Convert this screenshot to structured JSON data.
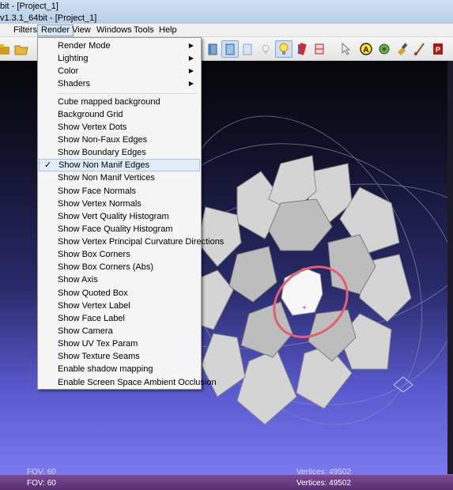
{
  "window": {
    "title": "bit - [Project_1]",
    "subtitle": "v1.3.1_64bit - [Project_1]"
  },
  "menubar": {
    "items": [
      {
        "label": "Filters"
      },
      {
        "label": "Render"
      },
      {
        "label": "View"
      },
      {
        "label": "Windows"
      },
      {
        "label": "Tools"
      },
      {
        "label": "Help"
      }
    ]
  },
  "render_menu": {
    "submenus": [
      {
        "label": "Render Mode"
      },
      {
        "label": "Lighting"
      },
      {
        "label": "Color"
      },
      {
        "label": "Shaders"
      }
    ],
    "items": [
      {
        "label": "Cube mapped background"
      },
      {
        "label": "Background Grid"
      },
      {
        "label": "Show Vertex Dots"
      },
      {
        "label": "Show Non-Faux Edges"
      },
      {
        "label": "Show Boundary Edges"
      },
      {
        "label": "Show Non Manif Edges",
        "checked": true
      },
      {
        "label": "Show Non Manif Vertices"
      },
      {
        "label": "Show Face Normals"
      },
      {
        "label": "Show Vertex Normals"
      },
      {
        "label": "Show Vert Quality Histogram"
      },
      {
        "label": "Show Face Quality Histogram"
      },
      {
        "label": "Show Vertex Principal Curvature Directions"
      },
      {
        "label": "Show Box Corners"
      },
      {
        "label": "Show Box Corners (Abs)"
      },
      {
        "label": "Show Axis"
      },
      {
        "label": "Show Quoted Box"
      },
      {
        "label": "Show Vertex Label"
      },
      {
        "label": "Show Face Label"
      },
      {
        "label": "Show Camera"
      },
      {
        "label": "Show UV Tex Param"
      },
      {
        "label": "Show Texture Seams"
      },
      {
        "label": "Enable shadow mapping"
      },
      {
        "label": "Enable Screen Space Ambient Occlusion"
      }
    ],
    "check_mark": "✓"
  },
  "viewport": {
    "fov": "FOV: 60",
    "vertices": "Vertices: 49502"
  },
  "statusbar": {
    "fov": "FOV: 60",
    "vertices": "Vertices: 49502"
  },
  "toolbar_icons": [
    "open-project-icon",
    "open-folder-icon",
    "box-icon",
    "box-selected-icon",
    "box-transparent-icon",
    "light-icon",
    "lightbulb-icon",
    "color-pen-icon",
    "texture-icon",
    "select-icon",
    "annotate-icon",
    "mesh-icon",
    "paint-icon",
    "brush-icon",
    "pdf-icon"
  ],
  "colors": {
    "menu_highlight": "#e2ecf8",
    "status_bar": "#5a2e72",
    "selection_circle": "#e06070"
  }
}
